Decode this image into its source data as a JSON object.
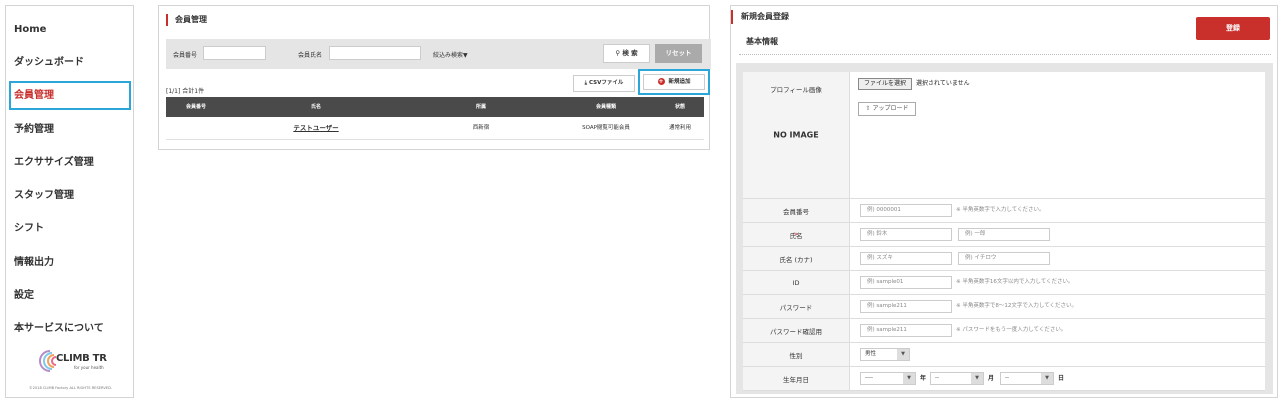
{
  "sidebar": {
    "items": [
      {
        "label": "Home"
      },
      {
        "label": "ダッシュボード"
      },
      {
        "label": "会員管理"
      },
      {
        "label": "予約管理"
      },
      {
        "label": "エクササイズ管理"
      },
      {
        "label": "スタッフ管理"
      },
      {
        "label": "シフト"
      },
      {
        "label": "情報出力"
      },
      {
        "label": "設定"
      },
      {
        "label": "本サービスについて"
      }
    ],
    "logo_text": "CLIMB TR",
    "logo_sub": "for your health",
    "copyright": "©2018 CLIMB Factory ALL RIGHTS RESERVED."
  },
  "members": {
    "title": "会員管理",
    "search": {
      "member_no_label": "会員番号",
      "member_name_label": "会員氏名",
      "filter_label": "絞込み検索▼",
      "search_button": "検 索",
      "reset_button": "リセット"
    },
    "count": "[1/1] 合計1件",
    "csv_button": "CSVファイル",
    "add_button": "新規追加",
    "table": {
      "headers": [
        "会員番号",
        "氏名",
        "所属",
        "会員種類",
        "状態"
      ],
      "rows": [
        {
          "no": "",
          "name": "テストユーザー",
          "affiliation": "西新宿",
          "type": "SOAP閲覧可能会員",
          "status": "通常利用"
        }
      ]
    }
  },
  "registration": {
    "title": "新規会員登録",
    "register_button": "登録",
    "section": "基本情報",
    "profile_label": "プロフィール画像",
    "file_button": "ファイルを選択",
    "file_none": "選択されていません",
    "upload_button": "アップロード",
    "no_image": "NO IMAGE",
    "fields": {
      "member_no": {
        "label": "会員番号",
        "placeholder": "例) 0000001",
        "hint": "※ 半角英数字で入力してください。"
      },
      "name": {
        "label": "氏名",
        "required": "*",
        "placeholder_last": "例) 鈴木",
        "placeholder_first": "例) 一郎"
      },
      "kana": {
        "label": "氏名 (カナ)",
        "placeholder_last": "例) スズキ",
        "placeholder_first": "例) イチロウ"
      },
      "id": {
        "label": "ID",
        "placeholder": "例) sample01",
        "hint": "※ 半角英数字16文字以内で入力してください。"
      },
      "password": {
        "label": "パスワード",
        "placeholder": "例) sample211",
        "hint": "※ 半角英数字で8〜12文字で入力してください。"
      },
      "password_confirm": {
        "label": "パスワード確認用",
        "placeholder": "例) sample211",
        "hint": "※ パスワードをもう一度入力してください。"
      },
      "gender": {
        "label": "性別",
        "value": "男性"
      },
      "birthday": {
        "label": "生年月日",
        "year_value": "----",
        "month_value": "--",
        "day_value": "--",
        "year_unit": "年",
        "month_unit": "月",
        "day_unit": "日"
      }
    }
  },
  "colors": {
    "accent": "#c9302c",
    "highlight": "#2aa6d9",
    "table_header": "#4a4a4a"
  },
  "icons": [
    "search-icon",
    "download-icon",
    "plus-circle-icon",
    "upload-icon",
    "chevron-down-icon",
    "climb-logo-icon"
  ]
}
